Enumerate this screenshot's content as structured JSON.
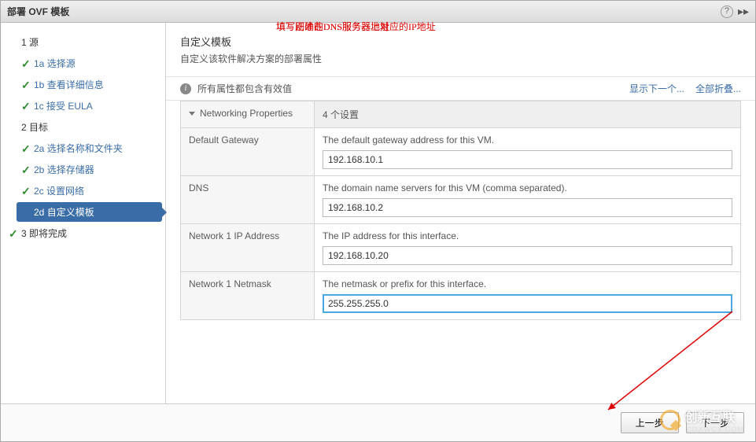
{
  "titlebar": {
    "title": "部署 OVF 模板"
  },
  "sidebar": {
    "s1": {
      "num": "1",
      "label": "源"
    },
    "s1a": {
      "num": "1a",
      "label": "选择源"
    },
    "s1b": {
      "num": "1b",
      "label": "查看详细信息"
    },
    "s1c": {
      "num": "1c",
      "label": "接受 EULA"
    },
    "s2": {
      "num": "2",
      "label": "目标"
    },
    "s2a": {
      "num": "2a",
      "label": "选择名称和文件夹"
    },
    "s2b": {
      "num": "2b",
      "label": "选择存储器"
    },
    "s2c": {
      "num": "2c",
      "label": "设置网络"
    },
    "s2d": {
      "num": "2d",
      "label": "自定义模板"
    },
    "s3": {
      "num": "3",
      "label": "即将完成"
    }
  },
  "content": {
    "heading": "自定义模板",
    "subheading": "自定义该软件解决方案的部署属性",
    "info_text": "所有属性都包含有效值",
    "link_show_next": "显示下一个...",
    "link_collapse_all": "全部折叠...",
    "section": {
      "title": "Networking Properties",
      "count": "4 个设置"
    },
    "rows": {
      "gateway": {
        "label": "Default Gateway",
        "desc": "The default gateway address for this VM.",
        "value": "192.168.10.1"
      },
      "dns": {
        "label": "DNS",
        "desc": "The domain name servers for this VM (comma separated).",
        "value": "192.168.10.2"
      },
      "ip": {
        "label": "Network 1 IP Address",
        "desc": "The IP address for this interface.",
        "value": "192.168.10.20"
      },
      "netmask": {
        "label": "Network 1 Netmask",
        "desc": "The netmask or prefix for this interface.",
        "value": "255.255.255.0"
      }
    },
    "annotations": {
      "dns": "填写正确的DNS服务器地址",
      "ip": "填写刚才在DNS服务器上对应的IP地址"
    }
  },
  "footer": {
    "back": "上一步",
    "next": "下一步"
  },
  "watermark": {
    "brand": "创新互联",
    "sub": "CDXWCX.COM"
  }
}
